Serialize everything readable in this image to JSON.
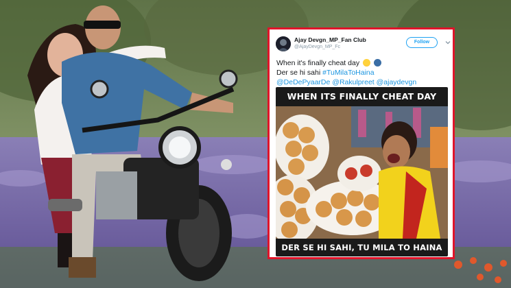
{
  "tweet": {
    "display_name": "Ajay Devgn_MP_Fan Club",
    "handle": "@AjayDevgn_MP_Fc",
    "follow_label": "Follow",
    "text_line1": "When it's finally cheat day",
    "text_line2_plain": "Der se hi sahi",
    "hashtag": "#TuMilaToHaina",
    "mention1": "@DeDePyaarDe",
    "mention2": "@Rakulpreet",
    "mention3": "@ajaydevgn",
    "emojis": [
      "laughing-emoji",
      "speaking-head-emoji"
    ]
  },
  "meme": {
    "top_caption": "WHEN ITS FINALLY CHEAT DAY",
    "bottom_caption": "DER SE HI SAHI, TU MILA TO HAINA"
  },
  "colors": {
    "card_border": "#e0142a",
    "link": "#1b95e0",
    "follow": "#1da1f2"
  }
}
